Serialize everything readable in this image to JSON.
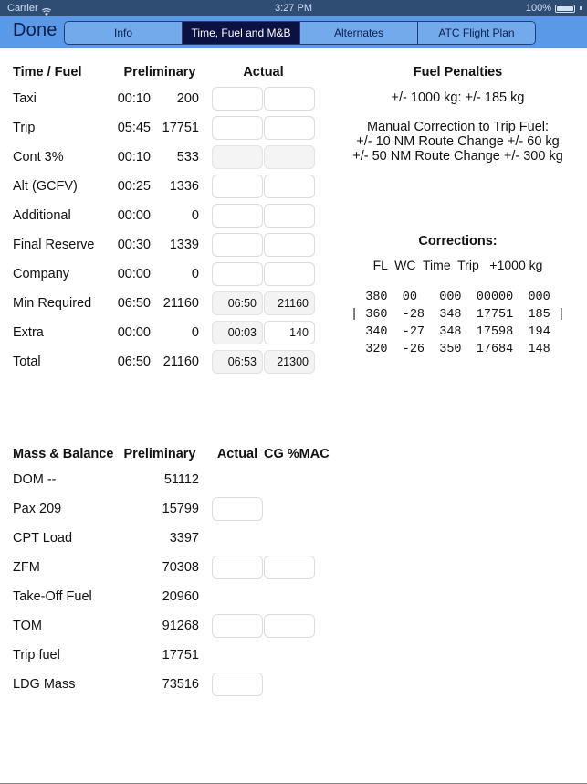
{
  "statusbar": {
    "carrier": "Carrier",
    "wifi_icon": "wifi-icon",
    "time": "3:27 PM",
    "battery_percent": "100%",
    "battery_icon": "battery-full-icon"
  },
  "navbar": {
    "done_label": "Done",
    "tabs": [
      {
        "label": "Info",
        "active": false
      },
      {
        "label": "Time, Fuel and M&B",
        "active": true
      },
      {
        "label": "Alternates",
        "active": false
      },
      {
        "label": "ATC Flight Plan",
        "active": false
      }
    ]
  },
  "fuel_table": {
    "headers": {
      "label": "Time / Fuel",
      "preliminary": "Preliminary",
      "actual": "Actual"
    },
    "rows": [
      {
        "label": "Taxi",
        "prelim_time": "00:10",
        "prelim_fuel": "200",
        "actual_time": "",
        "actual_fuel": "",
        "readonly": false
      },
      {
        "label": "Trip",
        "prelim_time": "05:45",
        "prelim_fuel": "17751",
        "actual_time": "",
        "actual_fuel": "",
        "readonly": false
      },
      {
        "label": "Cont 3%",
        "prelim_time": "00:10",
        "prelim_fuel": "533",
        "actual_time": "",
        "actual_fuel": "",
        "readonly": true
      },
      {
        "label": "Alt (GCFV)",
        "prelim_time": "00:25",
        "prelim_fuel": "1336",
        "actual_time": "",
        "actual_fuel": "",
        "readonly": false
      },
      {
        "label": "Additional",
        "prelim_time": "00:00",
        "prelim_fuel": "0",
        "actual_time": "",
        "actual_fuel": "",
        "readonly": false
      },
      {
        "label": "Final Reserve",
        "prelim_time": "00:30",
        "prelim_fuel": "1339",
        "actual_time": "",
        "actual_fuel": "",
        "readonly": false
      },
      {
        "label": "Company",
        "prelim_time": "00:00",
        "prelim_fuel": "0",
        "actual_time": "",
        "actual_fuel": "",
        "readonly": false
      },
      {
        "label": "Min Required",
        "prelim_time": "06:50",
        "prelim_fuel": "21160",
        "actual_time": "06:50",
        "actual_fuel": "21160",
        "readonly": true
      },
      {
        "label": "Extra",
        "prelim_time": "00:00",
        "prelim_fuel": "0",
        "actual_time": "00:03",
        "actual_fuel": "140",
        "readonly": false
      },
      {
        "label": "Total",
        "prelim_time": "06:50",
        "prelim_fuel": "21160",
        "actual_time": "06:53",
        "actual_fuel": "21300",
        "readonly": true
      }
    ]
  },
  "fuel_penalties": {
    "title": "Fuel Penalties",
    "penalty_line": "+/- 1000 kg: +/-  185 kg",
    "manual_title": "Manual Correction to Trip Fuel:",
    "manual_line_1": "+/- 10 NM Route Change +/- 60 kg",
    "manual_line_2": "+/- 50 NM Route Change +/- 300 kg"
  },
  "corrections": {
    "title": "Corrections:",
    "columns": [
      "FL",
      "WC",
      "Time",
      "Trip",
      "+1000 kg"
    ],
    "header_text": "FL  WC  Time  Trip   +1000 kg",
    "rows": [
      "  380  00   000  00000  000  ",
      "| 360  -28  348  17751  185 |",
      "  340  -27  348  17598  194  ",
      "  320  -26  350  17684  148  "
    ]
  },
  "mass_balance": {
    "headers": {
      "label": "Mass & Balance",
      "preliminary": "Preliminary",
      "actual": "Actual",
      "cg": "CG %MAC"
    },
    "rows": [
      {
        "label": "DOM --",
        "preliminary": "51112",
        "actual": "",
        "cg": "",
        "has_actual": false,
        "has_cg": false
      },
      {
        "label": "Pax 209",
        "preliminary": "15799",
        "actual": "",
        "cg": "",
        "has_actual": true,
        "has_cg": false
      },
      {
        "label": "CPT Load",
        "preliminary": "3397",
        "actual": "",
        "cg": "",
        "has_actual": false,
        "has_cg": false
      },
      {
        "label": "ZFM",
        "preliminary": "70308",
        "actual": "",
        "cg": "",
        "has_actual": true,
        "has_cg": true
      },
      {
        "label": "Take-Off Fuel",
        "preliminary": "20960",
        "actual": "",
        "cg": "",
        "has_actual": false,
        "has_cg": false
      },
      {
        "label": "TOM",
        "preliminary": "91268",
        "actual": "",
        "cg": "",
        "has_actual": true,
        "has_cg": true
      },
      {
        "label": "Trip fuel",
        "preliminary": "17751",
        "actual": "",
        "cg": "",
        "has_actual": false,
        "has_cg": false
      },
      {
        "label": "LDG Mass",
        "preliminary": "73516",
        "actual": "",
        "cg": "",
        "has_actual": true,
        "has_cg": false
      }
    ]
  },
  "colors": {
    "navbar_blue": "#5a99e8",
    "segment_active": "#0b1140",
    "statusbar": "#2f4c73",
    "text_dark": "#111111",
    "input_readonly": "#f3f3f3"
  }
}
